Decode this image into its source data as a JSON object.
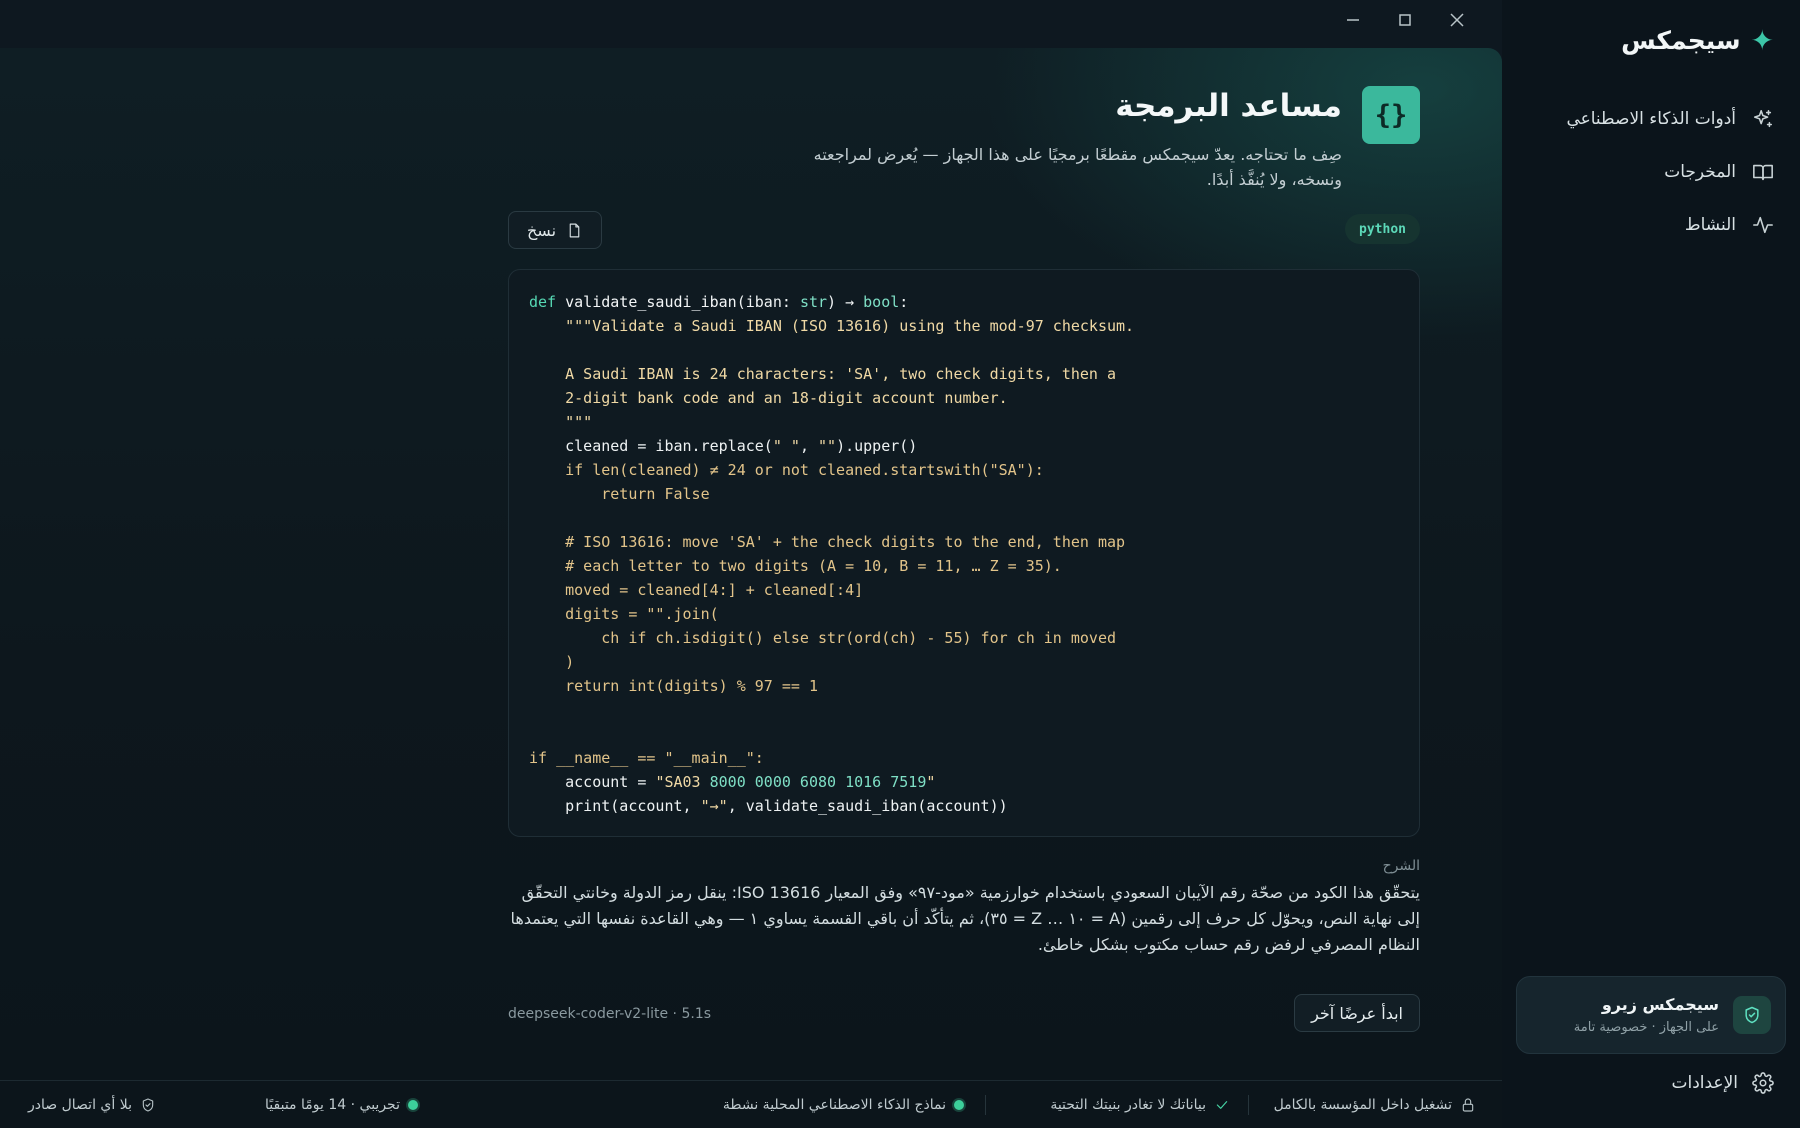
{
  "app": {
    "brand_name": "سيجمكس",
    "accent_color": "#3bb89c"
  },
  "sidebar": {
    "items": [
      {
        "label": "أدوات الذكاء الاصطناعي",
        "icon": "sparkles-icon"
      },
      {
        "label": "المخرجات",
        "icon": "book-icon"
      },
      {
        "label": "النشاط",
        "icon": "activity-icon"
      }
    ],
    "zero_card": {
      "title": "سيجمكس زيرو",
      "subtitle": "على الجهاز · خصوصية تامة",
      "icon": "shield-check-icon"
    },
    "settings_label": "الإعدادات"
  },
  "header": {
    "icon_glyph": "{}",
    "title": "مساعد البرمجة",
    "description": "صِف ما تحتاجه. يعدّ سيجمكس مقطعًا برمجيًا على هذا الجهاز — يُعرض لمراجعته ونسخه، ولا يُنفَّذ أبدًا."
  },
  "code_panel": {
    "language": "python",
    "copy_label": "نسخ"
  },
  "explanation": {
    "label": "الشرح",
    "text": "يتحقّق هذا الكود من صحّة رقم الآيبان السعودي باستخدام خوارزمية «مود-٩٧» وفق المعيار ISO 13616: ينقل رمز الدولة وخانتي التحقّق إلى نهاية النص، ويحوّل كل حرف إلى رقمين (A = ١٠ … Z = ٣٥)، ثم يتأكّد أن باقي القسمة يساوي ١ — وهي القاعدة نفسها التي يعتمدها النظام المصرفي لرفض رقم حساب مكتوب بشكل خاطئ."
  },
  "footer": {
    "meta": "deepseek-coder-v2-lite · 5.1s",
    "new_prompt_label": "ابدأ عرضًا آخر"
  },
  "statusbar": {
    "on_prem": "تشغيل داخل المؤسسة بالكامل",
    "data_stays": "بياناتك لا تغادر بنيتك التحتية",
    "models_active": "نماذج الذكاء الاصطناعي المحلية نشطة",
    "trial": "تجريبي · 14 يومًا متبقيًا",
    "no_outbound": "بلا أي اتصال صادر"
  }
}
